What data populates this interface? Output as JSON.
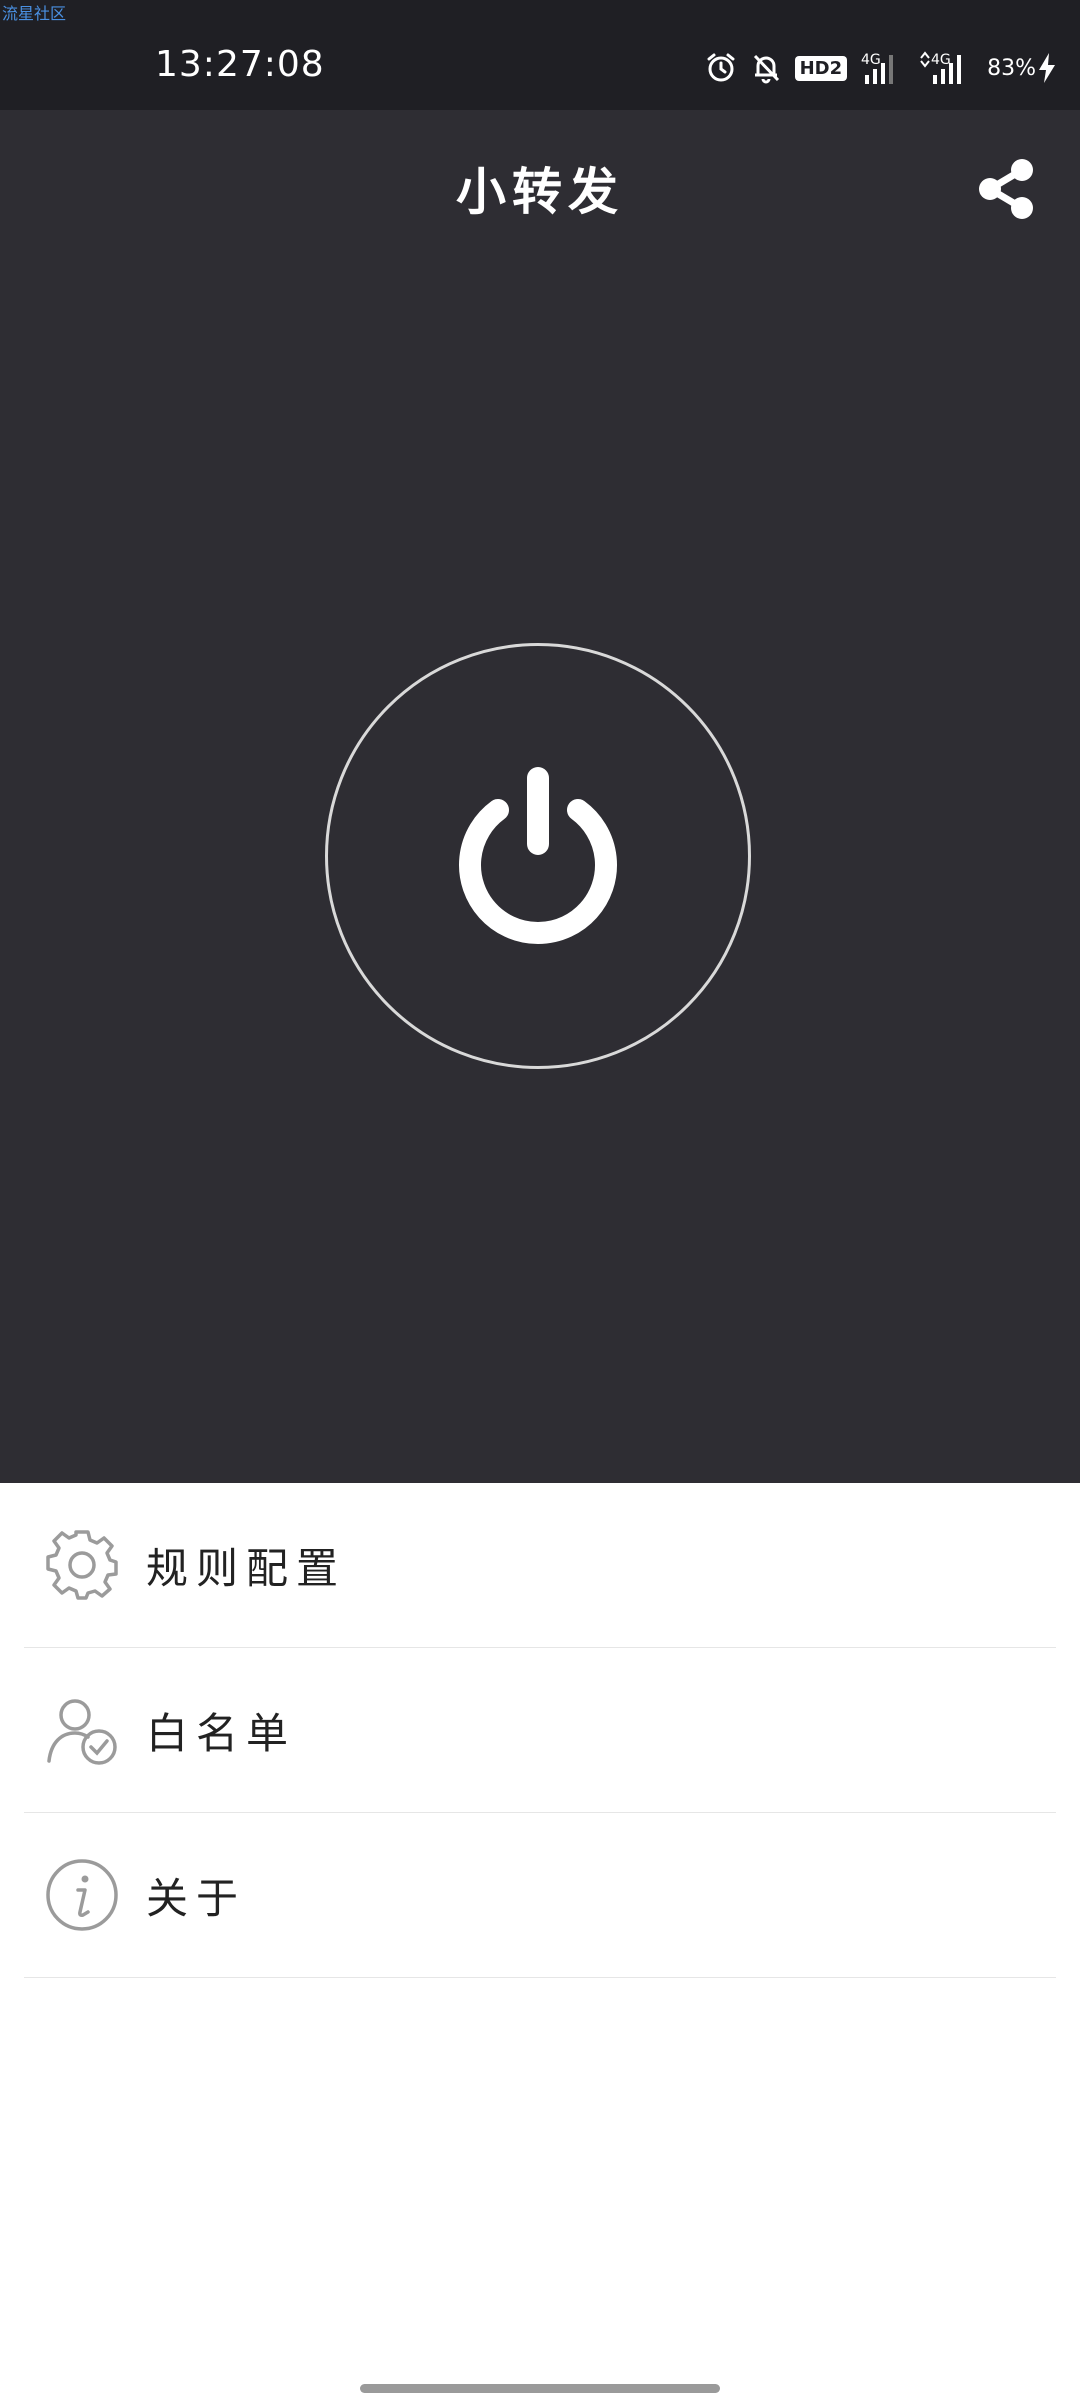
{
  "status_bar": {
    "watermark": "流星社区",
    "time": "13:27:08",
    "hd_badge": "HD2",
    "network1": "4G",
    "network2": "4G",
    "battery": "83%"
  },
  "header": {
    "title": "小转发"
  },
  "menu": {
    "items": [
      {
        "label": "规则配置",
        "icon": "gear-icon"
      },
      {
        "label": "白名单",
        "icon": "user-check-icon"
      },
      {
        "label": "关于",
        "icon": "info-icon"
      }
    ]
  },
  "colors": {
    "status_bar_bg": "#1f1f24",
    "hero_bg": "#2e2d33",
    "icon_gray": "#9b9b9b",
    "text_dark": "#222222"
  }
}
